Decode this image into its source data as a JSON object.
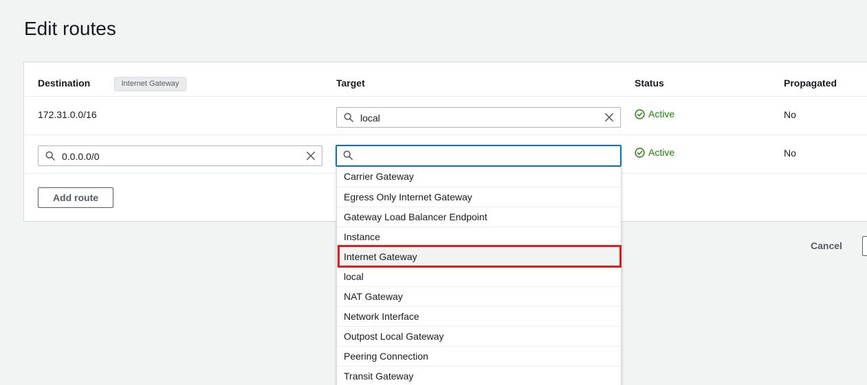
{
  "page_title": "Edit routes",
  "tooltip": "Internet Gateway",
  "columns": {
    "destination": "Destination",
    "target": "Target",
    "status": "Status",
    "propagated": "Propagated"
  },
  "routes": [
    {
      "destination": "172.31.0.0/16",
      "target_value": "local",
      "status": "Active",
      "propagated": "No"
    },
    {
      "destination_value": "0.0.0.0/0",
      "target_value": "",
      "status": "Active",
      "propagated": "No"
    }
  ],
  "add_route_label": "Add route",
  "cancel_label": "Cancel",
  "target_options": [
    "Carrier Gateway",
    "Egress Only Internet Gateway",
    "Gateway Load Balancer Endpoint",
    "Instance",
    "Internet Gateway",
    "local",
    "NAT Gateway",
    "Network Interface",
    "Outpost Local Gateway",
    "Peering Connection",
    "Transit Gateway"
  ],
  "highlighted_option": "Internet Gateway",
  "colors": {
    "active_status": "#1d8102",
    "focus_border": "#0073bb",
    "highlight": "#e3191a"
  }
}
